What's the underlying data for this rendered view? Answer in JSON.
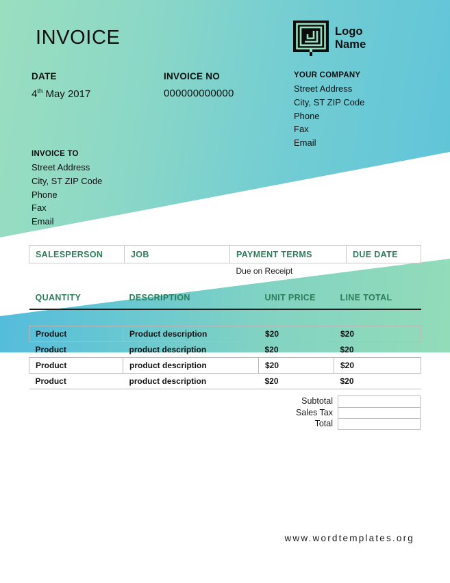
{
  "document": {
    "title": "INVOICE"
  },
  "logo": {
    "icon": "square-maze-logo-icon",
    "line1": "Logo",
    "line2": "Name"
  },
  "meta": {
    "date_label": "DATE",
    "date_day": "4",
    "date_ordinal": "th",
    "date_rest": " May 2017",
    "invoice_no_label": "INVOICE NO",
    "invoice_no_value": "000000000000"
  },
  "company": {
    "title": "YOUR COMPANY",
    "lines": [
      "Street Address",
      "City, ST ZIP Code",
      "Phone",
      "Fax",
      "Email"
    ]
  },
  "bill_to": {
    "title": "INVOICE TO",
    "lines": [
      "Street Address",
      "City, ST ZIP Code",
      "Phone",
      "Fax",
      "Email"
    ]
  },
  "terms": {
    "headers": [
      "SALESPERSON",
      "JOB",
      "PAYMENT TERMS",
      "DUE DATE"
    ],
    "values": [
      "",
      "",
      "Due on Receipt",
      ""
    ]
  },
  "items": {
    "headers": [
      "QUANTITY",
      "DESCRIPTION",
      "UNIT PRICE",
      "LINE TOTAL"
    ],
    "rows": [
      {
        "style": "boxed",
        "quantity": "Product",
        "description": "Product description",
        "unit_price": "$20",
        "line_total": "$20"
      },
      {
        "style": "ruled",
        "quantity": "Product",
        "description": "product description",
        "unit_price": "$20",
        "line_total": "$20"
      },
      {
        "style": "boxed",
        "quantity": "Product",
        "description": "product description",
        "unit_price": "$20",
        "line_total": "$20"
      },
      {
        "style": "ruled",
        "quantity": "Product",
        "description": "product description",
        "unit_price": "$20",
        "line_total": "$20"
      }
    ]
  },
  "totals": {
    "rows": [
      {
        "label": "Subtotal",
        "value": ""
      },
      {
        "label": "Sales Tax",
        "value": ""
      },
      {
        "label": "Total",
        "value": ""
      }
    ]
  },
  "footer": {
    "url": "www.wordtemplates.org"
  },
  "colors": {
    "gradient_green": "#9ADEC0",
    "gradient_blue": "#5FC4D9",
    "heading_green": "#2E7D5B",
    "text_black": "#101010",
    "rule_gray": "#b9b9b9"
  }
}
